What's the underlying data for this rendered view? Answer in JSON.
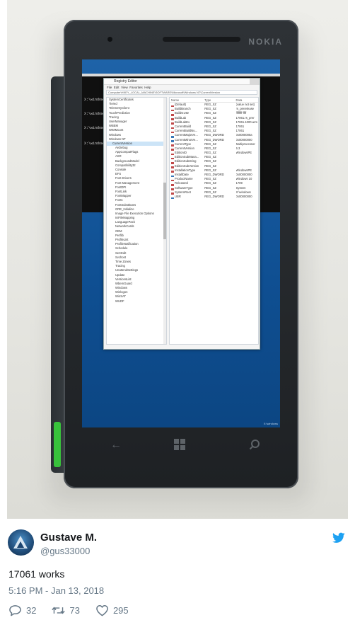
{
  "photo": {
    "phone_brand": "NOKIA",
    "regedit": {
      "title": "Registry Editor",
      "menu": [
        "File",
        "Edit",
        "View",
        "Favorites",
        "Help"
      ],
      "address": "Computer\\HKEY_LOCAL_MACHINE\\SOFTWARE\\Microsoft\\Windows NT\\CurrentVersion",
      "tree": [
        "SystemCertificates",
        "Tiered",
        "TelemetryClient",
        "TouchPrediction",
        "Tracing",
        "UserManager",
        "WBEM",
        "WIMMount",
        "Windows",
        "Windows NT",
        "CurrentVersion",
        "AeDebug",
        "AppCompatFlags",
        "ASR",
        "BackgroundModel",
        "Compatibility32",
        "Console",
        "EFS",
        "Font Drivers",
        "Font Management",
        "FontDPI",
        "FontLink",
        "FontMapper",
        "Fonts",
        "FontSubstitutes",
        "GRE_Initialize",
        "Image File Execution Options",
        "IniFileMapping",
        "LanguagePack",
        "NetworkCards",
        "OEM",
        "Perflib",
        "ProfileList",
        "ProfileNotification",
        "Schedule",
        "SeCEdit",
        "Svchost",
        "Time Zones",
        "Tracing",
        "UnattendSettings",
        "Update",
        "VersionsList",
        "WbemGuard",
        "Windows",
        "Winlogon",
        "WinSAT",
        "WUDF"
      ],
      "selected_tree_item": "CurrentVersion",
      "list_headers": [
        "Name",
        "Type",
        "Data"
      ],
      "values": [
        {
          "name": "(Default)",
          "type": "REG_SZ",
          "data": "(value not set)",
          "kind": "sz"
        },
        {
          "name": "BuildBranch",
          "type": "REG_SZ",
          "data": "rs_prerelease",
          "kind": "sz"
        },
        {
          "name": "BuildGUID",
          "type": "REG_SZ",
          "data": "ffffffff-ffff",
          "kind": "sz"
        },
        {
          "name": "BuildLab",
          "type": "REG_SZ",
          "data": "17061.rs_prer",
          "kind": "sz"
        },
        {
          "name": "BuildLabEx",
          "type": "REG_SZ",
          "data": "17061.1000.arm",
          "kind": "sz"
        },
        {
          "name": "CurrentBuild",
          "type": "REG_SZ",
          "data": "17061",
          "kind": "sz"
        },
        {
          "name": "CurrentBuildNu...",
          "type": "REG_SZ",
          "data": "17061",
          "kind": "sz"
        },
        {
          "name": "CurrentMajorVe...",
          "type": "REG_DWORD",
          "data": "0x0000000a",
          "kind": "bin"
        },
        {
          "name": "CurrentMinorVe...",
          "type": "REG_DWORD",
          "data": "0x00000000",
          "kind": "bin"
        },
        {
          "name": "CurrentType",
          "type": "REG_SZ",
          "data": "Multiprocessor",
          "kind": "sz"
        },
        {
          "name": "CurrentVersion",
          "type": "REG_SZ",
          "data": "6.3",
          "kind": "sz"
        },
        {
          "name": "EditionID",
          "type": "REG_SZ",
          "data": "WindowsPE",
          "kind": "sz"
        },
        {
          "name": "EditionSubMana...",
          "type": "REG_SZ",
          "data": "",
          "kind": "sz"
        },
        {
          "name": "EditionSubstring",
          "type": "REG_SZ",
          "data": "",
          "kind": "sz"
        },
        {
          "name": "EditionSubVersion",
          "type": "REG_SZ",
          "data": "",
          "kind": "sz"
        },
        {
          "name": "InstallationType",
          "type": "REG_SZ",
          "data": "WindowsPE",
          "kind": "sz"
        },
        {
          "name": "InstallDate",
          "type": "REG_DWORD",
          "data": "0x00000000",
          "kind": "bin"
        },
        {
          "name": "ProductName",
          "type": "REG_SZ",
          "data": "Windows 10",
          "kind": "sz"
        },
        {
          "name": "ReleaseId",
          "type": "REG_SZ",
          "data": "1709",
          "kind": "sz"
        },
        {
          "name": "SoftwareType",
          "type": "REG_SZ",
          "data": "System",
          "kind": "sz"
        },
        {
          "name": "SystemRoot",
          "type": "REG_SZ",
          "data": "X:\\windows",
          "kind": "sz"
        },
        {
          "name": "UBR",
          "type": "REG_DWORD",
          "data": "0x00000000",
          "kind": "bin"
        }
      ]
    },
    "cmd_lines": [
      "X:\\windows>",
      "X:\\windows>regedit",
      "X:\\windows>",
      "X:\\windows>"
    ],
    "watermark": "X:\\windows"
  },
  "tweet": {
    "name": "Gustave M.",
    "handle": "@gus33000",
    "text": "17061 works",
    "timestamp": "5:16 PM - Jan 13, 2018",
    "replies": "32",
    "retweets": "73",
    "likes": "295"
  },
  "colors": {
    "twitter_blue": "#1da1f2",
    "muted": "#657786",
    "text": "#14171a"
  }
}
